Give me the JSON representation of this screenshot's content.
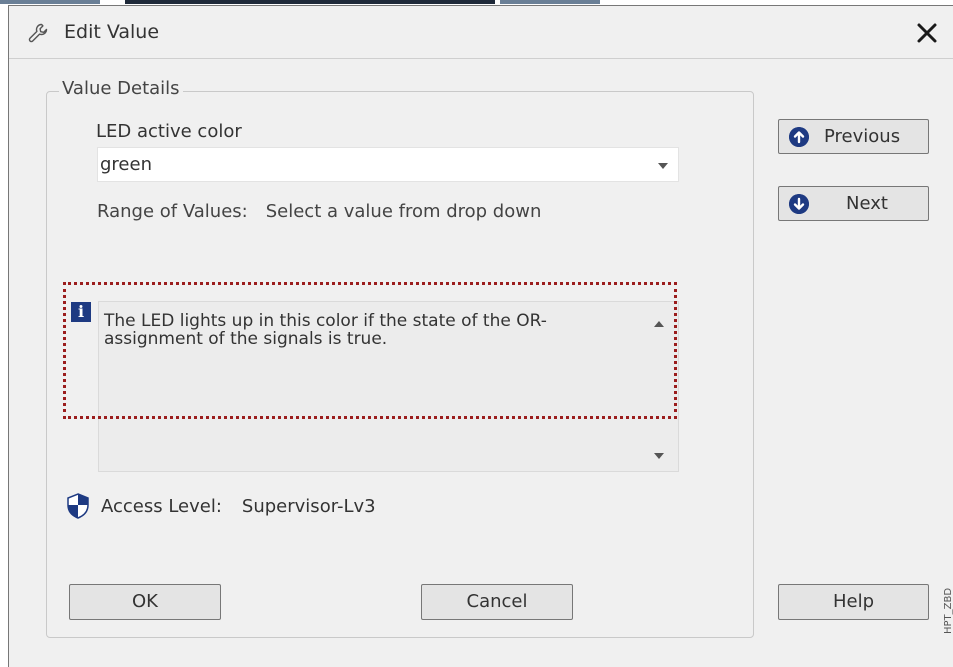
{
  "dialog": {
    "title": "Edit Value",
    "title_icon": "wrench-icon",
    "close_icon": "close-icon"
  },
  "group": {
    "title": "Value Details",
    "field_label": "LED active color",
    "selected_value": "green",
    "range_label": "Range of Values:",
    "range_value": "Select a value from drop down",
    "description": "The LED lights up in this color if the state of the OR-assignment of the signals is true.",
    "info_icon": "info-icon",
    "access_label": "Access Level:",
    "access_value": "Supervisor-Lv3",
    "access_icon": "shield-icon"
  },
  "nav": {
    "previous_label": "Previous",
    "next_label": "Next",
    "previous_icon": "arrow-up-circle-icon",
    "next_icon": "arrow-down-circle-icon"
  },
  "buttons": {
    "ok": "OK",
    "cancel": "Cancel",
    "help": "Help"
  },
  "watermark": "HPT_ZBD",
  "colors": {
    "accent": "#1e3a82",
    "highlight": "#9b1d1d",
    "dialog_bg": "#f0f0f0"
  }
}
